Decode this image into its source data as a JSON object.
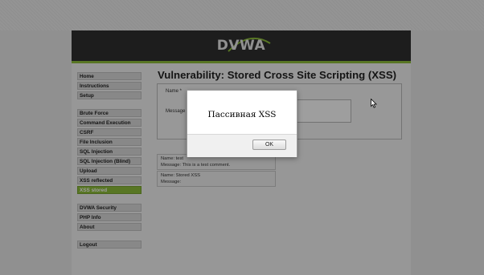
{
  "app": {
    "logo_text": "DVWA",
    "page_title": "Vulnerability: Stored Cross Site Scripting (XSS)"
  },
  "menu": {
    "group1": [
      "Home",
      "Instructions",
      "Setup"
    ],
    "group2": [
      "Brute Force",
      "Command Execution",
      "CSRF",
      "File Inclusion",
      "SQL Injection",
      "SQL Injection (Blind)",
      "Upload",
      "XSS reflected",
      "XSS stored"
    ],
    "group3": [
      "DVWA Security",
      "PHP Info",
      "About"
    ],
    "group4": [
      "Logout"
    ],
    "selected": "XSS stored"
  },
  "form": {
    "name_label": "Name *",
    "message_label": "Message"
  },
  "comments": [
    {
      "name": "Name: test",
      "message": "Message: This is a test comment."
    },
    {
      "name": "Name: Stored XSS",
      "message": "Message:"
    }
  ],
  "dialog": {
    "message": "Пассивная XSS",
    "ok_label": "OK"
  },
  "colors": {
    "accent": "#8fbe3b",
    "header_bg": "#2f2f2f"
  }
}
